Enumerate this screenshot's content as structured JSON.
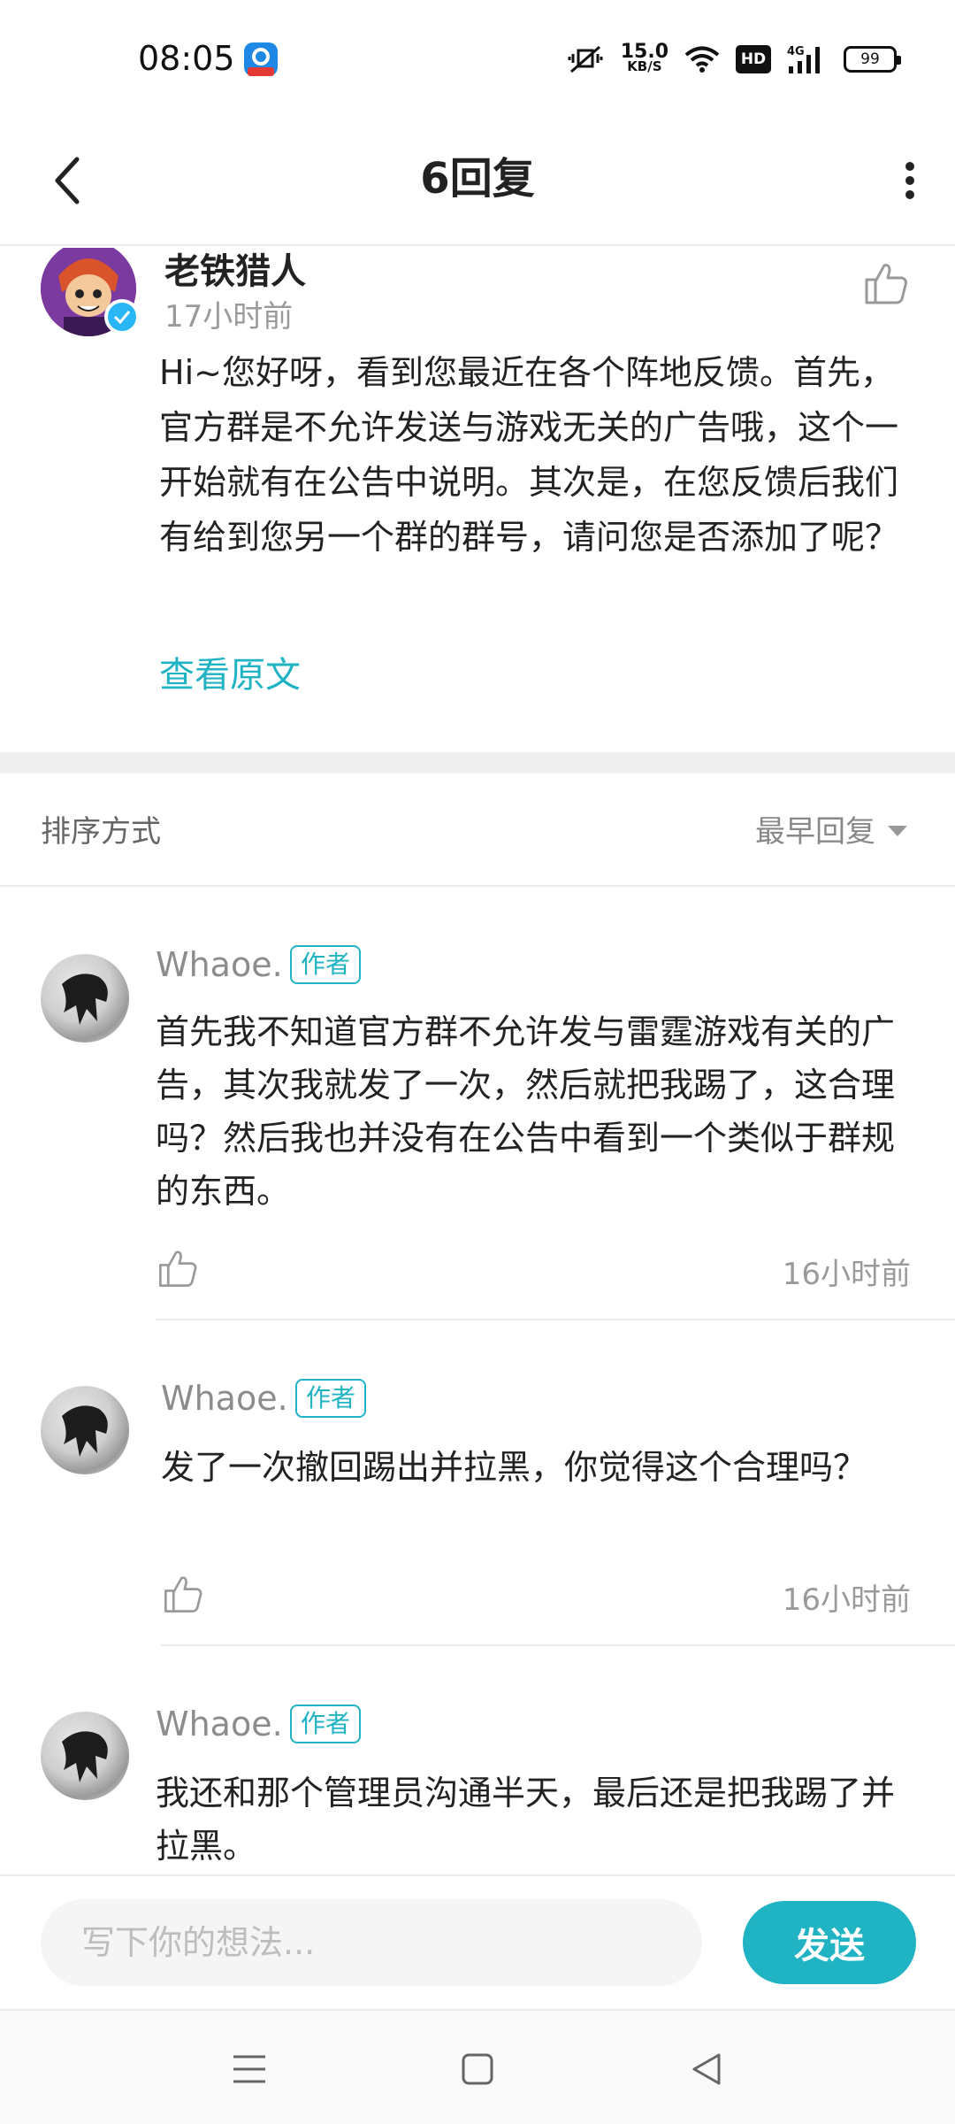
{
  "status_bar": {
    "time": "08:05",
    "speed_value": "15.0",
    "speed_unit": "KB/S",
    "hd_label": "HD",
    "network": "4G",
    "battery": "99",
    "icons": [
      "app-notification-icon",
      "mute-vibrate-icon",
      "wifi-icon",
      "hd-icon",
      "signal-icon",
      "battery-icon"
    ]
  },
  "header": {
    "title": "6回复",
    "back_icon": "chevron-left-icon",
    "more_icon": "more-vertical-icon"
  },
  "original_comment": {
    "username": "老铁猎人",
    "time": "17小时前",
    "body": "Hi~您好呀，看到您最近在各个阵地反馈。首先，官方群是不允许发送与游戏无关的广告哦，这个一开始就有在公告中说明。其次是，在您反馈后我们有给到您另一个群的群号，请问您是否添加了呢？",
    "view_original": "查看原文",
    "like_icon": "thumbs-up-icon"
  },
  "sort": {
    "label": "排序方式",
    "selected": "最早回复"
  },
  "replies": [
    {
      "username": "Whaoe.",
      "tag": "作者",
      "text": "首先我不知道官方群不允许发与雷霆游戏有关的广告，其次我就发了一次，然后就把我踢了，这合理吗？然后我也并没有在公告中看到一个类似于群规的东西。",
      "time": "16小时前"
    },
    {
      "username": "Whaoe.",
      "tag": "作者",
      "text": "发了一次撤回踢出并拉黑，你觉得这个合理吗？",
      "time": "16小时前"
    },
    {
      "username": "Whaoe.",
      "tag": "作者",
      "text": "我还和那个管理员沟通半天，最后还是把我踢了并拉黑。",
      "time": ""
    }
  ],
  "composer": {
    "placeholder": "写下你的想法...",
    "send_label": "发送"
  },
  "colors": {
    "accent": "#1fb3c4",
    "muted_text": "#9a9a9a",
    "divider": "#efefef"
  }
}
